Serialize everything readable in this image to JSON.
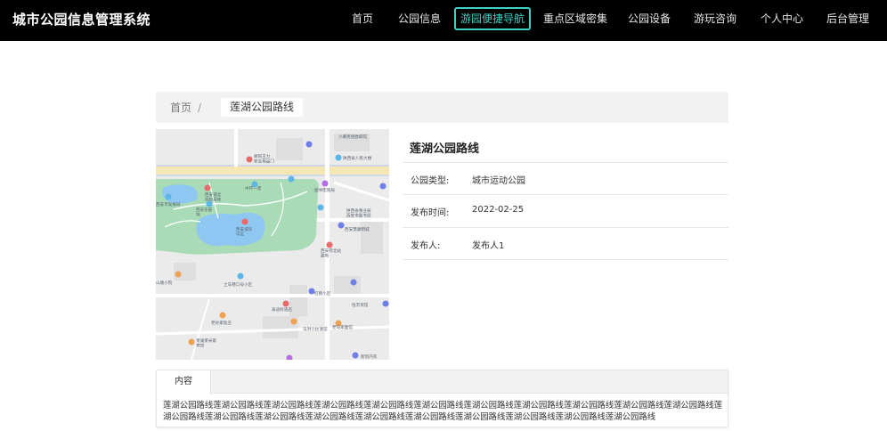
{
  "header": {
    "brand": "城市公园信息管理系统",
    "nav": [
      "首页",
      "公园信息",
      "游园便捷导航",
      "重点区域密集",
      "公园设备",
      "游玩咨询",
      "个人中心",
      "后台管理"
    ],
    "active_index": 2,
    "accent_color": "#3fd1c3"
  },
  "breadcrumb": {
    "home": "首页",
    "separator": "/",
    "current": "莲湖公园路线"
  },
  "map": {
    "labels": {
      "l1": "小寨民俗欧麻馆",
      "l2": "胡同王力\n安全用品门",
      "l3": "陕西省人民大楼",
      "l4": "西安城北\n巡检基地",
      "l5": "中环一景",
      "l6": "图书宏观局",
      "l7": "西安市发展局",
      "l8": "陕西省事业局\n西安市图书局",
      "l9": "西安东部\n地",
      "l10": "西安城华\n中区",
      "l11": "西安府北站\n路地",
      "l12": "西安慧康明城",
      "l13": "山塘小院",
      "l14": "土车巷口号小区",
      "l15": "红锁小区",
      "l16": "恒丰宾馆",
      "l17": "泰迪好酒店",
      "l18": "老孙家饭庄",
      "l19": "马洪小炒清馆",
      "l20": "老马家面馆",
      "l21": "莱湖莱米家\n宾馆",
      "l22": "新凯内衣"
    }
  },
  "info": {
    "title": "莲湖公园路线",
    "rows": [
      {
        "label": "公园类型:",
        "value": "城市运动公园"
      },
      {
        "label": "发布时间:",
        "value": "2022-02-25"
      },
      {
        "label": "发布人:",
        "value": "发布人1"
      }
    ]
  },
  "content": {
    "tab_label": "内容",
    "text": "莲湖公园路线莲湖公园路线莲湖公园路线莲湖公园路线莲湖公园路线莲湖公园路线莲湖公园路线莲湖公园路线莲湖公园路线莲湖公园路线莲湖公园路线莲湖公园路线莲湖公园路线莲湖公园路线莲湖公园路线莲湖公园路线莲湖公园路线莲湖公园路线莲湖公园路线莲湖公园路线莲湖公园路线"
  }
}
